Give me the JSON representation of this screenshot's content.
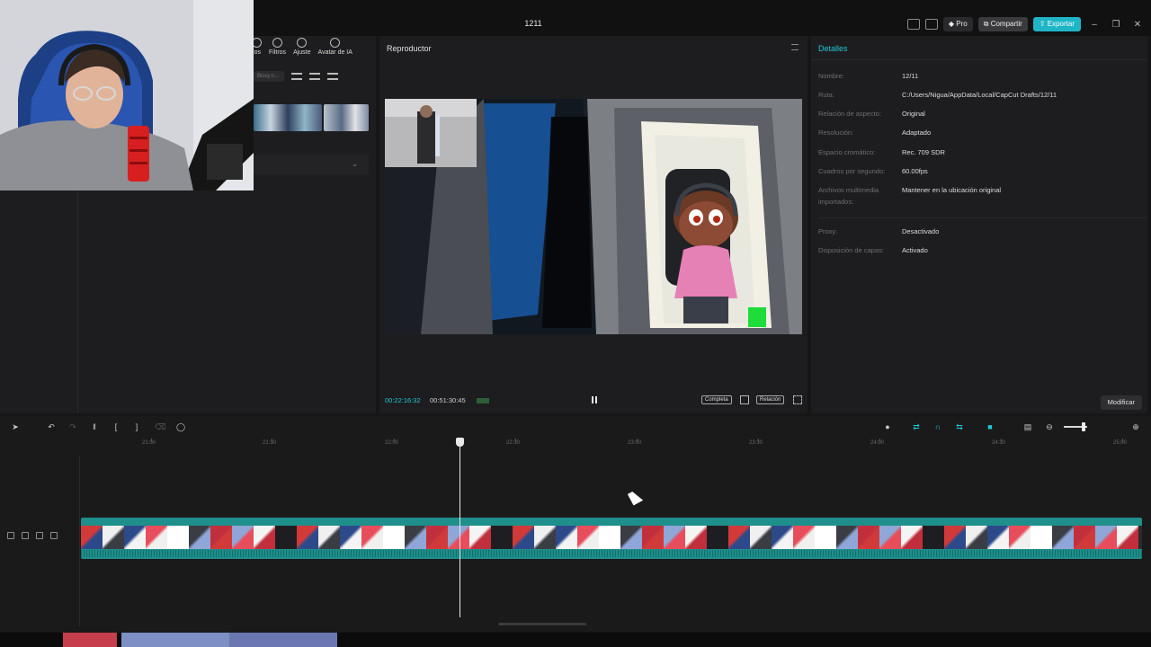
{
  "window": {
    "title": "1211"
  },
  "titlebar": {
    "pro_label": "Pro",
    "share_label": "Compartir",
    "export_label": "Exportar"
  },
  "media": {
    "tabs": [
      {
        "label": "los",
        "icon": "stickers-icon"
      },
      {
        "label": "Filtros",
        "icon": "filters-icon"
      },
      {
        "label": "Ajuste",
        "icon": "adjust-icon"
      },
      {
        "label": "Avatar de IA",
        "icon": "ai-avatar-icon"
      }
    ],
    "search_placeholder": "Búsq n..."
  },
  "player": {
    "title": "Reproductor",
    "current_time": "00:22:16:32",
    "total_time": "00:51:30:45",
    "complete_label": "Completa",
    "ratio_label": "Relación"
  },
  "details": {
    "title": "Detalles",
    "rows": [
      {
        "label": "Nombre:",
        "value": "12/11"
      },
      {
        "label": "Ruta:",
        "value": "C:/Users/Nigua/AppData/Local/CapCut Drafts/12/11"
      },
      {
        "label": "Relación de aspecto:",
        "value": "Original"
      },
      {
        "label": "Resolución:",
        "value": "Adaptado"
      },
      {
        "label": "Espacio cromático:",
        "value": "Rec. 709 SDR"
      },
      {
        "label": "Cuadros por segundo:",
        "value": "60.00fps"
      },
      {
        "label": "Archivos multimedia importados:",
        "value": "Mantener en la ubicación original"
      },
      {
        "label": "Proxy:",
        "value": "Desactivado"
      },
      {
        "label": "Disposición de capas:",
        "value": "Activado"
      }
    ],
    "modify_label": "Modificar"
  },
  "timeline": {
    "ruler_labels": [
      "21:00",
      "21:30",
      "22:00",
      "22:30",
      "23:00",
      "23:30",
      "24:00",
      "24:30",
      "25:00"
    ],
    "zoom_level": 0.75
  },
  "colors": {
    "accent": "#1fc9d8",
    "clip": "#1f8f8c",
    "export": "#1fb5c6"
  }
}
